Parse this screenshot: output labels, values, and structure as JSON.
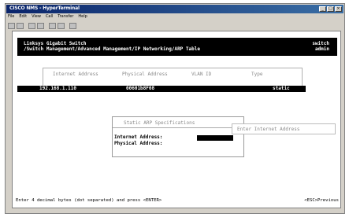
{
  "window": {
    "title": "CISCO NMS - HyperTerminal"
  },
  "menu": [
    "File",
    "Edit",
    "View",
    "Call",
    "Transfer",
    "Help"
  ],
  "header": {
    "line1": "Linksys Gigabit Switch",
    "line2": "/Switch Management/Advanced Management/IP Networking/ARP Table",
    "right1": "switch",
    "right2": "admin"
  },
  "table": {
    "columns": [
      "Internet Address",
      "Physical Address",
      "VLAN ID",
      "Type"
    ],
    "selected_row": {
      "ip": "192.168.1.110",
      "mac": "00601b8F08",
      "type": "static"
    }
  },
  "popup": {
    "title": "Static ARP Specifications",
    "fields": [
      {
        "label": "Internet Address:",
        "value": ""
      },
      {
        "label": "Physical Address:",
        "value": ""
      }
    ]
  },
  "hint": "Enter Internet Address",
  "status": {
    "left": "Enter 4 decimal bytes (dot separated) and press <ENTER>",
    "right": "<ESC>Previous"
  }
}
